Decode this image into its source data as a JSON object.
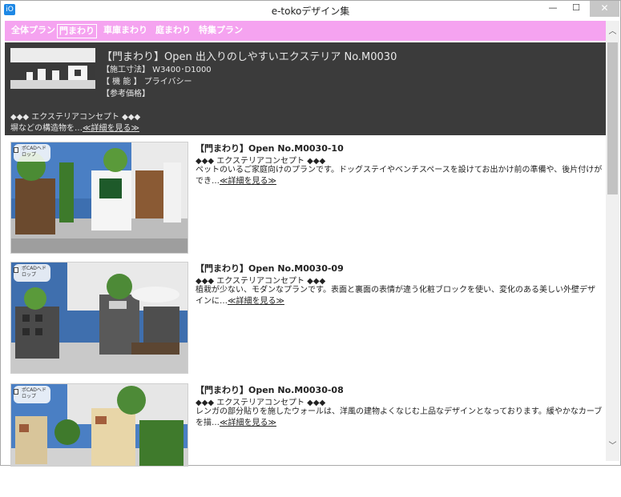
{
  "window": {
    "title": "e-tokoデザイン集",
    "app_icon_glyph": "iO",
    "minimize_glyph": "—",
    "maximize_glyph": "☐",
    "close_glyph": "✕"
  },
  "nav": {
    "items": [
      {
        "label": "全体プラン"
      },
      {
        "label": "門まわり"
      },
      {
        "label": "車庫まわり"
      },
      {
        "label": "庭まわり"
      },
      {
        "label": "特集プラン"
      }
    ],
    "active_index": 1,
    "bg_color": "#f5a3f0"
  },
  "featured": {
    "title": "【門まわり】Open  出入りのしやすいエクステリア  No.M0030",
    "size_label": "【施工寸法】 W3400･D1000",
    "function_label": "【  機  能  】 プライバシー",
    "price_label": "【参考価格】",
    "concept": "◆◆◆  エクステリアコンセプト  ◆◆◆",
    "desc_text": "塀などの構造物を…",
    "link_text": "≪詳細を見る≫"
  },
  "plans": [
    {
      "title": "【門まわり】Open  No.M0030-10",
      "concept": "◆◆◆  エクステリアコンセプト  ◆◆◆",
      "desc_text": "ペットのいるご家庭向けのプランです。ドッグステイやベンチスペースを設けてお出かけ前の準備や、後片付けができ…",
      "link_text": "≪詳細を見る≫",
      "badge": "ポCADへドロップ"
    },
    {
      "title": "【門まわり】Open  No.M0030-09",
      "concept": "◆◆◆  エクステリアコンセプト  ◆◆◆",
      "desc_text": "植栽が少ない、モダンなプランです。表面と裏面の表情が違う化粧ブロックを使い、変化のある美しい外壁デザインに…",
      "link_text": "≪詳細を見る≫",
      "badge": "ポCADへドロップ"
    },
    {
      "title": "【門まわり】Open  No.M0030-08",
      "concept": "◆◆◆  エクステリアコンセプト  ◆◆◆",
      "desc_text": "レンガの部分貼りを施したウォールは、洋風の建物よくなじむ上品なデザインとなっております。緩やかなカーブを描…",
      "link_text": "≪詳細を見る≫",
      "badge": "ポCADへドロップ"
    }
  ],
  "scrollbar": {
    "up_glyph": "︿",
    "down_glyph": "﹀"
  }
}
